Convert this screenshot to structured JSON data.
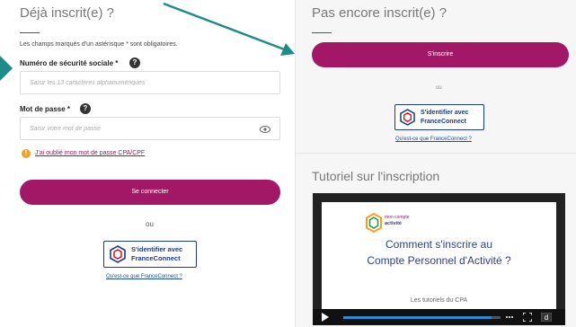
{
  "login": {
    "title": "Déjà inscrit(e) ?",
    "required_note": "Les champs marqués d'un astérisque * sont obligatoires.",
    "ssn_label": "Numéro de sécurité sociale *",
    "ssn_placeholder": "Saisir les 13 caractères alphanumériques",
    "password_label": "Mot de passe *",
    "password_placeholder": "Saisir votre mot de passe",
    "forgot_link": "J'ai oublié mon mot de passe CPA/CPF",
    "connect_button": "Se connecter",
    "or": "ou",
    "fc_line1": "S'identifier avec",
    "fc_line2": "FranceConnect",
    "fc_what": "Qu'est-ce que FranceConnect ?"
  },
  "signup": {
    "title": "Pas encore inscrit(e) ?",
    "signup_button": "S'inscrire",
    "or": "ou",
    "fc_line1": "S'identifier avec",
    "fc_line2": "FranceConnect",
    "fc_what": "Qu'est-ce que FranceConnect ?"
  },
  "tutorial": {
    "title": "Tutoriel sur l'inscription",
    "logo_line1": "mon compte",
    "logo_line2": "activité",
    "slide_line1": "Comment s'inscrire au",
    "slide_line2": "Compte Personnel d'Activité ?",
    "slide_sub": "Les tutoriels du CPA",
    "progress": 0.94
  },
  "colors": {
    "primary": "#a31866",
    "franceconnect": "#1a3a8a",
    "arrow": "#1f8a8a"
  }
}
